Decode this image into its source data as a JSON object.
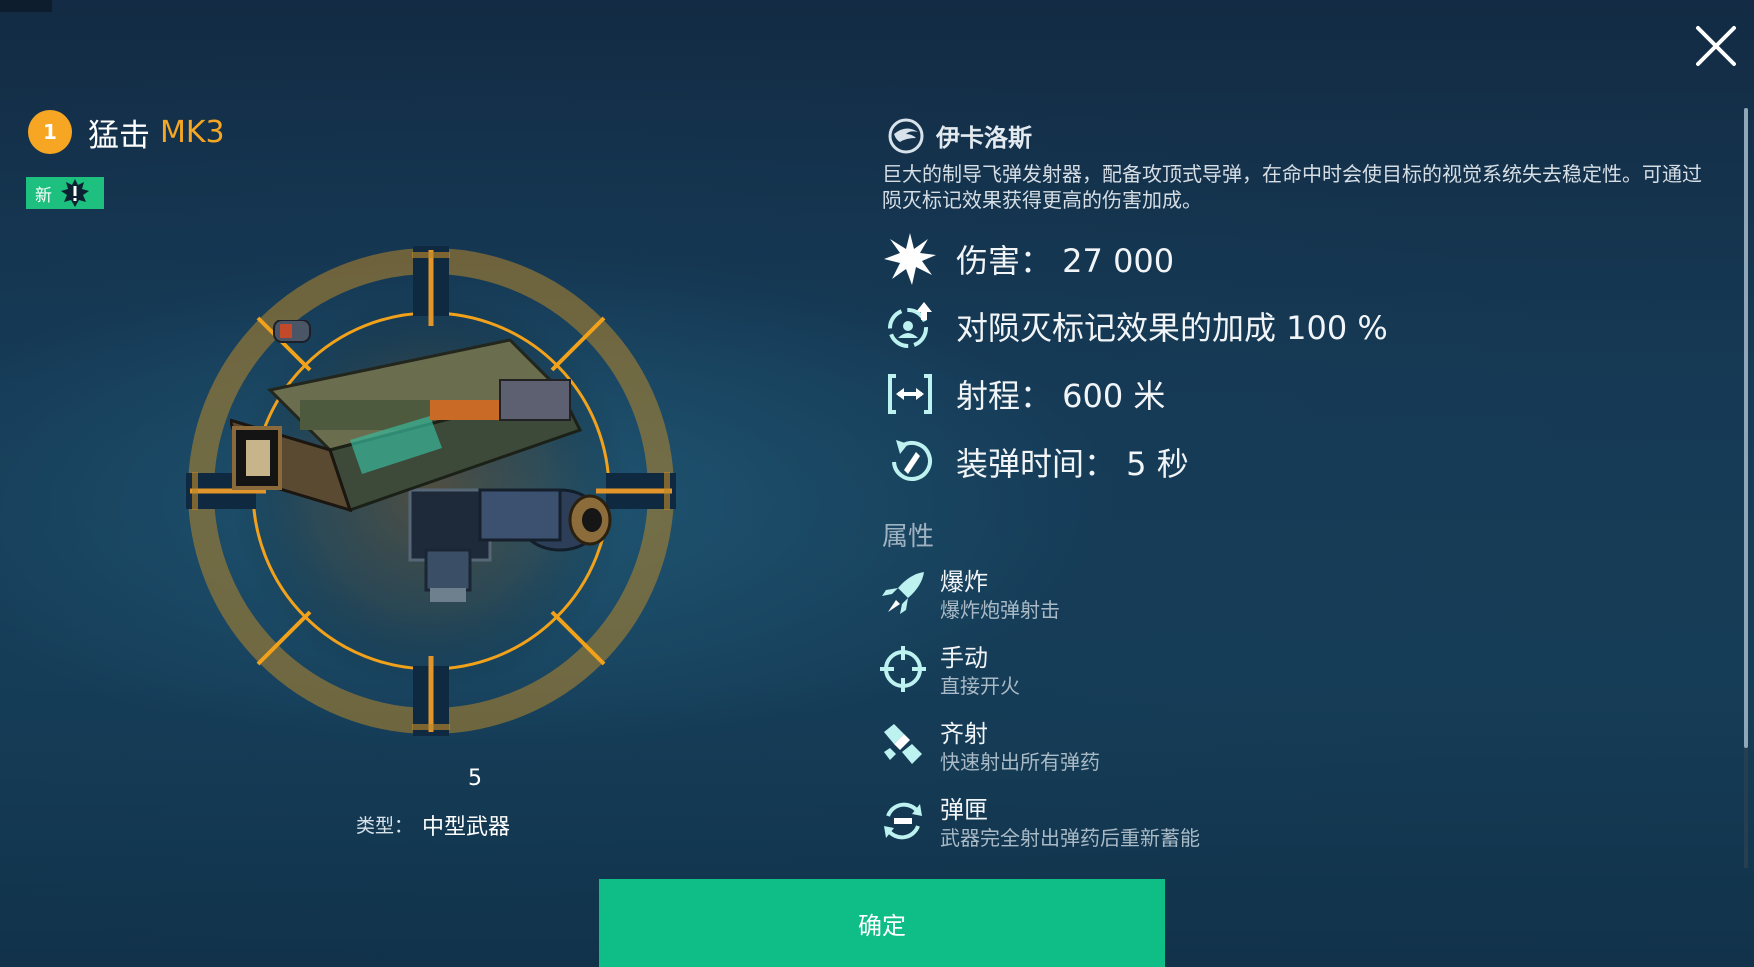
{
  "header": {
    "level": "1",
    "weapon_name": "猛击",
    "weapon_mark": "MK3",
    "new_badge": "新"
  },
  "preview": {
    "tier": "5",
    "type_label": "类型：",
    "type_value": "中型武器"
  },
  "faction": {
    "name": "伊卡洛斯"
  },
  "description": "巨大的制导飞弹发射器，配备攻顶式导弹，在命中时会使目标的视觉系统失去稳定性。可通过陨灭标记效果获得更高的伤害加成。",
  "stats": [
    {
      "icon": "damage-burst-icon",
      "text": "伤害： 27 000"
    },
    {
      "icon": "doom-mark-bonus-icon",
      "text": "对陨灭标记效果的加成 100 %"
    },
    {
      "icon": "range-icon",
      "text": "射程： 600 米"
    },
    {
      "icon": "reload-icon",
      "text": "装弹时间： 5 秒"
    }
  ],
  "attributes_header": "属性",
  "attributes": [
    {
      "icon": "rocket-icon",
      "title": "爆炸",
      "desc": "爆炸炮弹射击"
    },
    {
      "icon": "crosshair-icon",
      "title": "手动",
      "desc": "直接开火"
    },
    {
      "icon": "salvo-icon",
      "title": "齐射",
      "desc": "快速射出所有弹药"
    },
    {
      "icon": "magazine-icon",
      "title": "弹匣",
      "desc": "武器完全射出弹药后重新蓄能"
    }
  ],
  "confirm_label": "确定",
  "colors": {
    "accent_orange": "#f5a623",
    "accent_green": "#1ec07f",
    "button_green": "#0fbd87",
    "icon_cyan": "#bdf2f0"
  }
}
